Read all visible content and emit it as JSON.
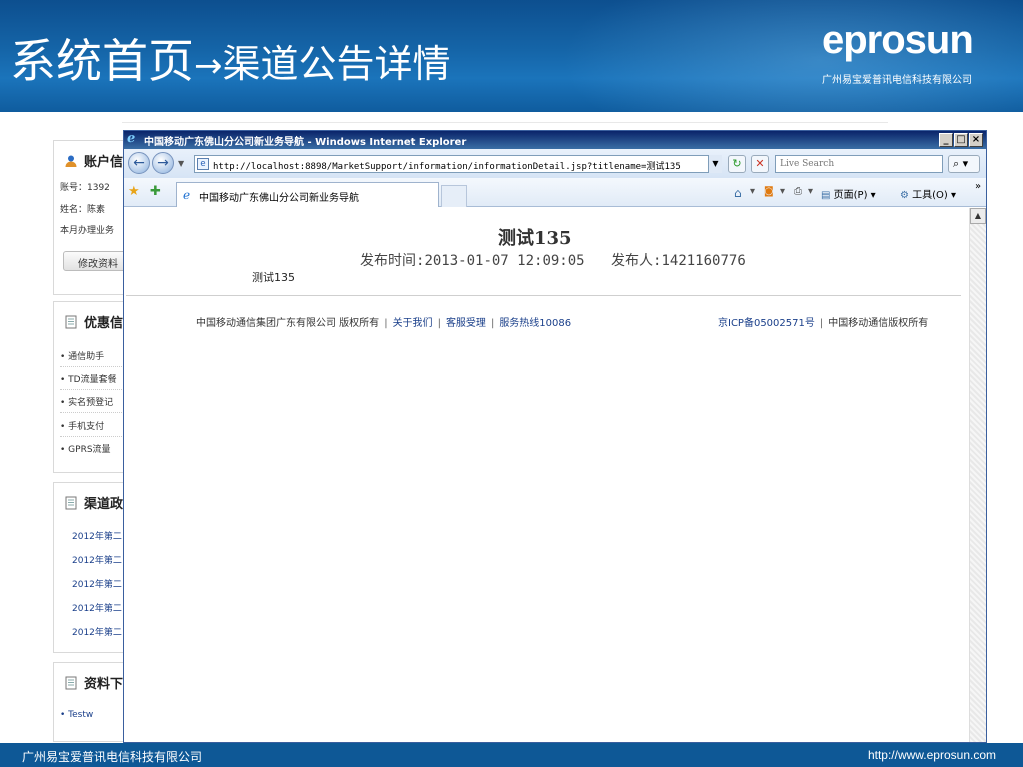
{
  "slide": {
    "title": "系统首页",
    "arrow": "→",
    "subtitle": "渠道公告详情",
    "logo": "eprosun",
    "logo_subtitle": "广州易宝爱普讯电信科技有限公司",
    "footer_left": "广州易宝爱普讯电信科技有限公司",
    "footer_right": "http://www.eprosun.com"
  },
  "bg_page": {
    "account": {
      "title": "账户信",
      "rows": [
        "账号：1392",
        "姓名：陈素",
        "本月办理业务"
      ],
      "edit_button": "修改资料"
    },
    "offers": {
      "title": "优惠信",
      "items": [
        "通信助手",
        "TD流量套餐",
        "实名预登记",
        "手机支付",
        "GPRS流量"
      ]
    },
    "channel": {
      "title": "渠道政",
      "items": [
        "2012年第二",
        "2012年第二",
        "2012年第二",
        "2012年第二",
        "2012年第二"
      ]
    },
    "downloads": {
      "title": "资料下",
      "items": [
        "Testw"
      ]
    }
  },
  "browser": {
    "window_title": "中国移动广东佛山分公司新业务导航 - Windows Internet Explorer",
    "address": "http://localhost:8898/MarketSupport/information/informationDetail.jsp?titlename=测试135",
    "search_placeholder": "Live Search",
    "tab_title": "中国移动广东佛山分公司新业务导航",
    "page_menu": "页面(P)",
    "tools_menu": "工具(O)",
    "chevron": "»"
  },
  "article": {
    "title": "测试135",
    "publish_time_label": "发布时间:",
    "publish_time": "2013-01-07 12:09:05",
    "publisher_label": "发布人:",
    "publisher": "1421160776",
    "body": "测试135"
  },
  "site_footer": {
    "copyright": "中国移动通信集团广东有限公司 版权所有",
    "links": [
      "关于我们",
      "客服受理",
      "服务热线10086"
    ],
    "icp": "京ICP备05002571号",
    "rights": "中国移动通信版权所有"
  },
  "colors": {
    "header_blue": "#1565a8",
    "footer_blue": "#0e5896",
    "link_blue": "#1a3f8a"
  }
}
